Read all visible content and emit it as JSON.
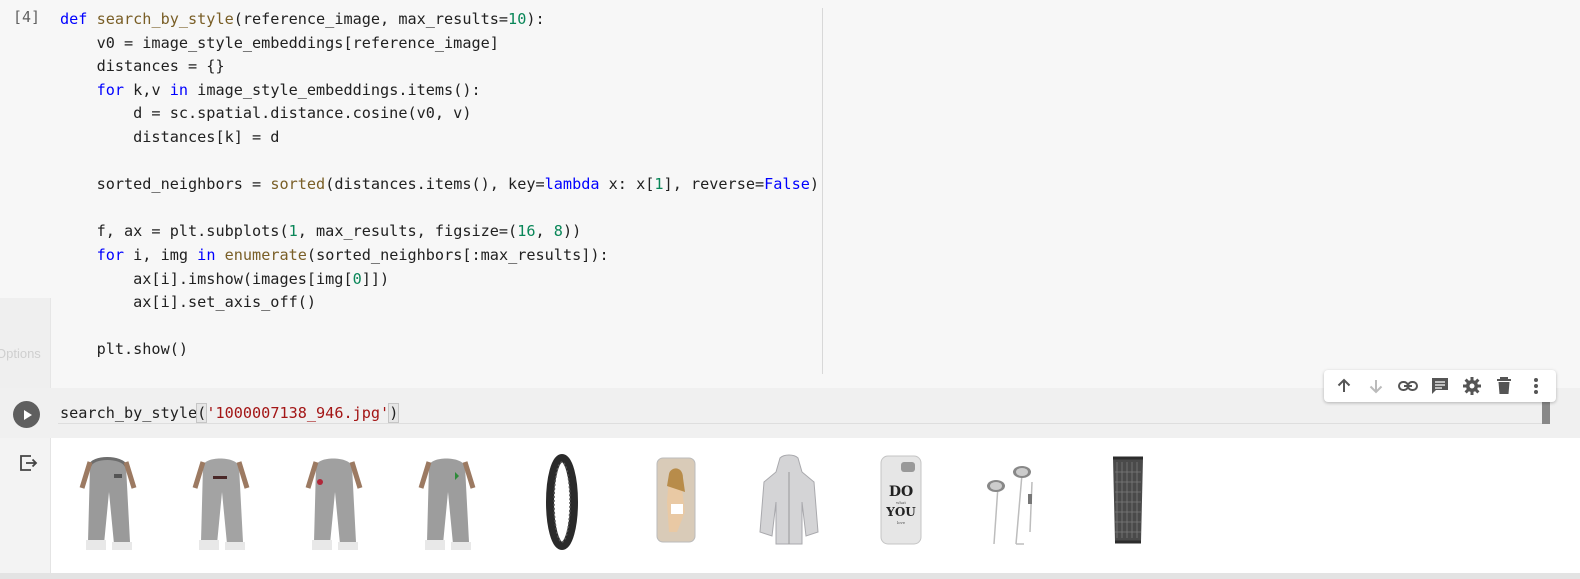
{
  "cell_code": {
    "execution_count": "[4]",
    "lines": [
      [
        {
          "t": "def ",
          "c": "kw"
        },
        {
          "t": "search_by_style",
          "c": "fn"
        },
        {
          "t": "(reference_image, max_results=",
          "c": ""
        },
        {
          "t": "10",
          "c": "num"
        },
        {
          "t": "):",
          "c": ""
        }
      ],
      [
        {
          "t": "    v0 = image_style_embeddings[reference_image]",
          "c": ""
        }
      ],
      [
        {
          "t": "    distances = {}",
          "c": ""
        }
      ],
      [
        {
          "t": "    ",
          "c": ""
        },
        {
          "t": "for",
          "c": "kw"
        },
        {
          "t": " k,v ",
          "c": ""
        },
        {
          "t": "in",
          "c": "kw"
        },
        {
          "t": " image_style_embeddings.items():",
          "c": ""
        }
      ],
      [
        {
          "t": "        d = sc.spatial.distance.cosine(v0, v)",
          "c": ""
        }
      ],
      [
        {
          "t": "        distances[k] = d",
          "c": ""
        }
      ],
      [
        {
          "t": "",
          "c": ""
        }
      ],
      [
        {
          "t": "    sorted_neighbors = ",
          "c": ""
        },
        {
          "t": "sorted",
          "c": "fn"
        },
        {
          "t": "(distances.items(), key=",
          "c": ""
        },
        {
          "t": "lambda",
          "c": "kw"
        },
        {
          "t": " x: x[",
          "c": ""
        },
        {
          "t": "1",
          "c": "num"
        },
        {
          "t": "], reverse=",
          "c": ""
        },
        {
          "t": "False",
          "c": "bool"
        },
        {
          "t": ")",
          "c": ""
        }
      ],
      [
        {
          "t": "",
          "c": ""
        }
      ],
      [
        {
          "t": "    f, ax = plt.subplots(",
          "c": ""
        },
        {
          "t": "1",
          "c": "num"
        },
        {
          "t": ", max_results, figsize=(",
          "c": ""
        },
        {
          "t": "16",
          "c": "num"
        },
        {
          "t": ", ",
          "c": ""
        },
        {
          "t": "8",
          "c": "num"
        },
        {
          "t": "))",
          "c": ""
        }
      ],
      [
        {
          "t": "    ",
          "c": ""
        },
        {
          "t": "for",
          "c": "kw"
        },
        {
          "t": " i, img ",
          "c": ""
        },
        {
          "t": "in",
          "c": "kw"
        },
        {
          "t": " ",
          "c": ""
        },
        {
          "t": "enumerate",
          "c": "fn"
        },
        {
          "t": "(sorted_neighbors[:max_results]):",
          "c": ""
        }
      ],
      [
        {
          "t": "        ax[i].imshow(images[img[",
          "c": ""
        },
        {
          "t": "0",
          "c": "num"
        },
        {
          "t": "]])",
          "c": ""
        }
      ],
      [
        {
          "t": "        ax[i].set_axis_off()",
          "c": ""
        }
      ],
      [
        {
          "t": "",
          "c": ""
        }
      ],
      [
        {
          "t": "    plt.show()",
          "c": ""
        }
      ]
    ]
  },
  "ghost_label": "Options",
  "active_cell": {
    "fn": "search_by_style",
    "open": "(",
    "arg": "'1000007138_946.jpg'",
    "close": ")"
  },
  "toolbar": {
    "icons": [
      "arrow-up-icon",
      "arrow-down-icon",
      "link-icon",
      "comment-icon",
      "gear-icon",
      "trash-icon",
      "more-vert-icon"
    ]
  },
  "output": {
    "thumbnails": [
      "sweatpants-gray-1",
      "sweatpants-gray-2",
      "sweatpants-gray-3",
      "sweatpants-gray-4",
      "bike-tire",
      "phone-case-photo",
      "hooded-jacket",
      "phone-case-do-what-you-love",
      "earphones",
      "trash-bin"
    ]
  },
  "colors": {
    "run_button": "#5f5f5f",
    "cell_bg": "#f7f7f7",
    "keyword": "#0000ff",
    "string": "#a31515",
    "number": "#098658"
  }
}
